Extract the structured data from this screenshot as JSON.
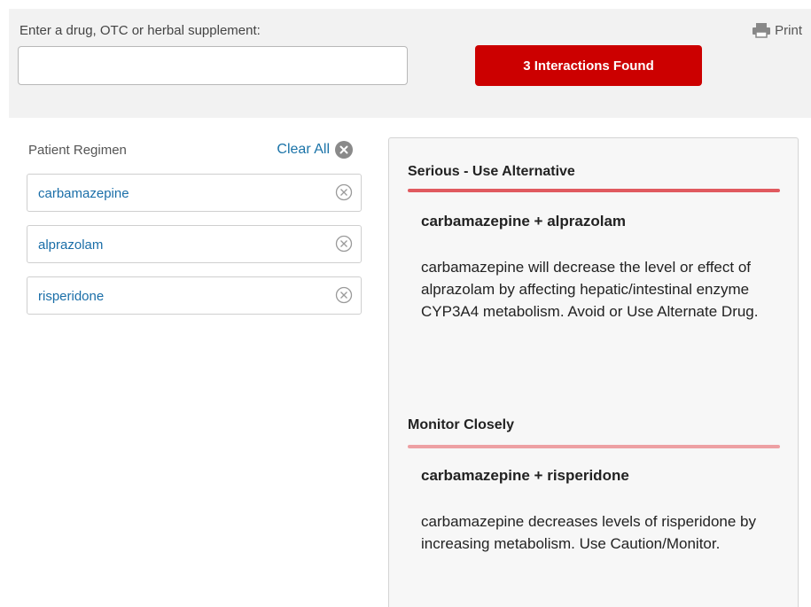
{
  "search": {
    "label": "Enter a drug, OTC or herbal supplement:",
    "value": "",
    "placeholder": ""
  },
  "interactions_button": "3 Interactions Found",
  "print_label": "Print",
  "regimen": {
    "title": "Patient Regimen",
    "clear_all": "Clear All",
    "drugs": [
      "carbamazepine",
      "alprazolam",
      "risperidone"
    ]
  },
  "results": [
    {
      "severity": "Serious - Use Alternative",
      "color": "#e05a5f",
      "pair": "carbamazepine + alprazolam",
      "description": "carbamazepine will decrease the level or effect of alprazolam by affecting hepatic/intestinal enzyme CYP3A4 metabolism. Avoid or Use Alternate Drug."
    },
    {
      "severity": "Monitor Closely",
      "color": "#eda0a3",
      "pair": "carbamazepine + risperidone",
      "description": "carbamazepine decreases levels of risperidone by increasing metabolism. Use Caution/Monitor."
    }
  ],
  "colors": {
    "accent_red": "#cc0000",
    "link_blue": "#1a6ea8"
  }
}
